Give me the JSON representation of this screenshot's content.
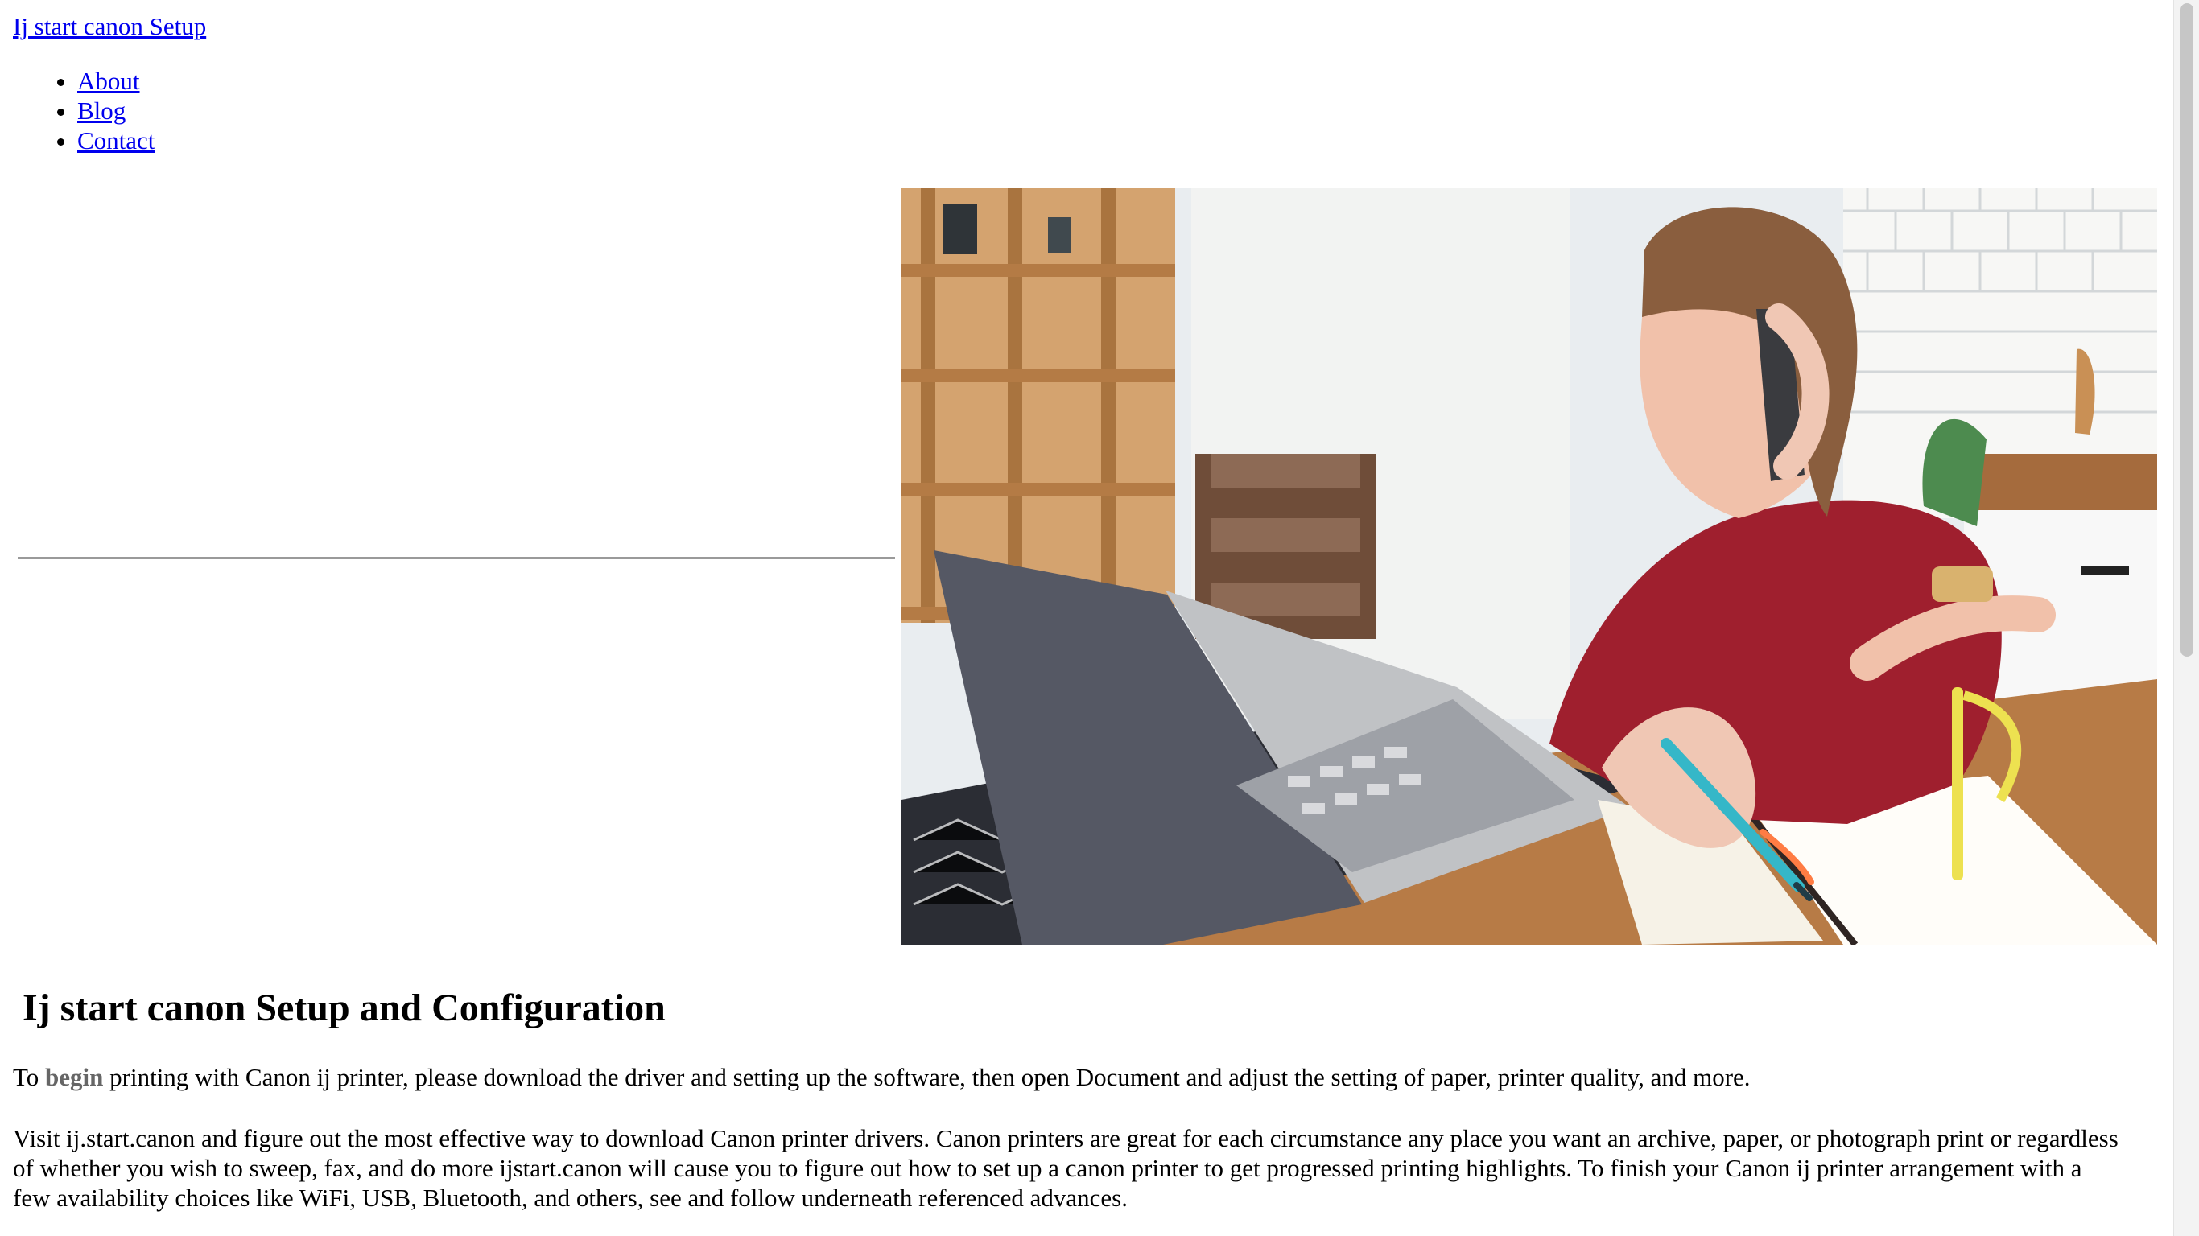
{
  "site": {
    "title": "Ij start canon Setup"
  },
  "nav": {
    "items": [
      {
        "label": "About"
      },
      {
        "label": "Blog"
      },
      {
        "label": "Contact"
      }
    ]
  },
  "hero": {
    "alt": "Woman talking on phone while writing in notebook beside a laptop",
    "colors": {
      "wall": "#e8ecef",
      "wood": "#b37a45",
      "shirt": "#9f1f2e",
      "laptop": "#5b5d66",
      "pen": "#38b7c8"
    }
  },
  "main": {
    "title": "Ij start canon Setup and Configuration",
    "intro": {
      "before": "To ",
      "strong": "begin",
      "after": " printing with Canon ij printer, please download the driver and setting up the software, then open Document and adjust the setting of paper, printer quality, and more."
    },
    "paragraph": "Visit ij.start.canon and figure out the most effective way to download Canon printer drivers. Canon printers are great for each circumstance any place you want an archive, paper, or photograph print or regardless of whether you wish to sweep, fax, and do more ijstart.canon will cause you to figure out how to set up a canon printer to get progressed printing highlights. To finish your Canon ij printer arrangement with a few availability choices like WiFi, USB, Bluetooth, and others, see and follow underneath referenced advances."
  },
  "scrollbar": {
    "position_percent": 0
  }
}
